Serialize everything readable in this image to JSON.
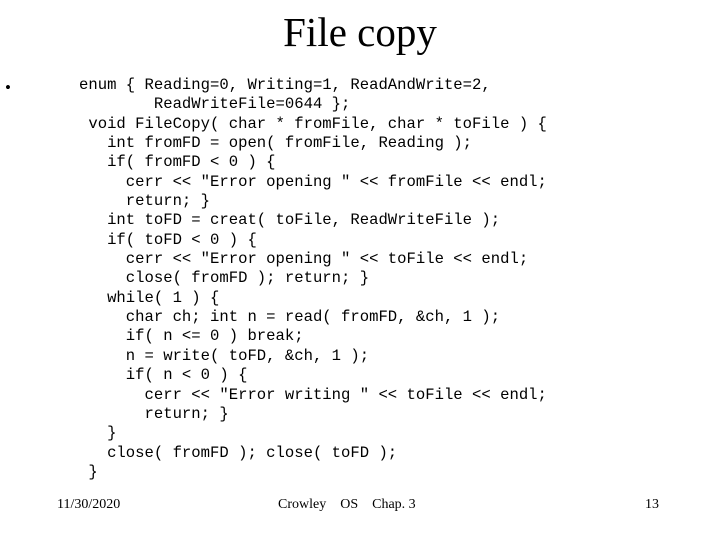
{
  "slide": {
    "title": "File copy",
    "bullet_glyph": "•",
    "code_lines": [
      "enum { Reading=0, Writing=1, ReadAndWrite=2,",
      "        ReadWriteFile=0644 };",
      " void FileCopy( char * fromFile, char * toFile ) {",
      "   int fromFD = open( fromFile, Reading );",
      "   if( fromFD < 0 ) {",
      "     cerr << \"Error opening \" << fromFile << endl;",
      "     return; }",
      "   int toFD = creat( toFile, ReadWriteFile );",
      "   if( toFD < 0 ) {",
      "     cerr << \"Error opening \" << toFile << endl;",
      "     close( fromFD ); return; }",
      "   while( 1 ) {",
      "     char ch; int n = read( fromFD, &ch, 1 );",
      "     if( n <= 0 ) break;",
      "     n = write( toFD, &ch, 1 );",
      "     if( n < 0 ) {",
      "       cerr << \"Error writing \" << toFile << endl;",
      "       return; }",
      "   }",
      "   close( fromFD ); close( toFD );",
      " }"
    ]
  },
  "footer": {
    "date": "11/30/2020",
    "author": "Crowley",
    "course": "OS",
    "chapter": "Chap. 3",
    "page_number": "13"
  },
  "colors": {
    "background": "#ffffff",
    "text": "#000000"
  }
}
